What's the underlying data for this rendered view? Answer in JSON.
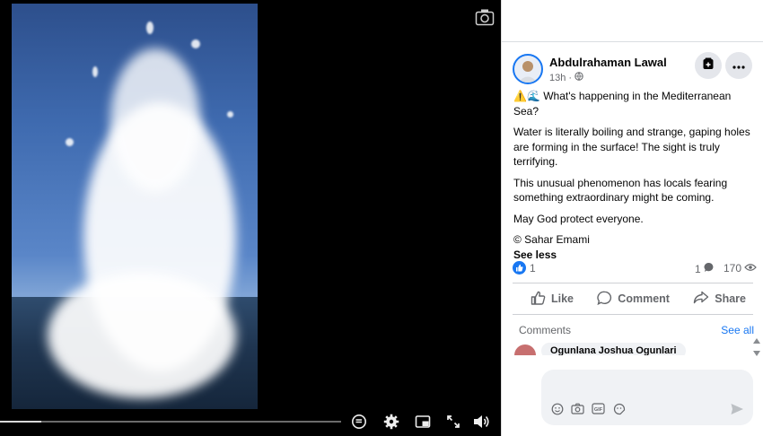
{
  "post": {
    "author": "Abdulrahaman Lawal",
    "time": "13h",
    "visibility_icon": "globe-icon",
    "title_line": "⚠️🌊 What's happening in the Mediterranean Sea?",
    "paragraph1": "Water is literally boiling and strange, gaping holes are forming in the surface! The sight is truly terrifying.",
    "paragraph2": "This unusual phenomenon has locals fearing something extraordinary might be coming.",
    "paragraph3": "May God protect everyone.",
    "credit": "© Sahar Emami",
    "see_less": "See less"
  },
  "stats": {
    "likes": "1",
    "comments": "1",
    "views": "170"
  },
  "actions": {
    "like": "Like",
    "comment": "Comment",
    "share": "Share"
  },
  "comments": {
    "title": "Comments",
    "see_all": "See all",
    "preview_author": "Ogunlana Joshua Ogunlari"
  },
  "composer": {
    "placeholder": ""
  },
  "video": {
    "progress": 0.12
  },
  "colors": {
    "accent": "#1877f2",
    "muted_text": "#65676b",
    "video_bg": "#000000"
  }
}
